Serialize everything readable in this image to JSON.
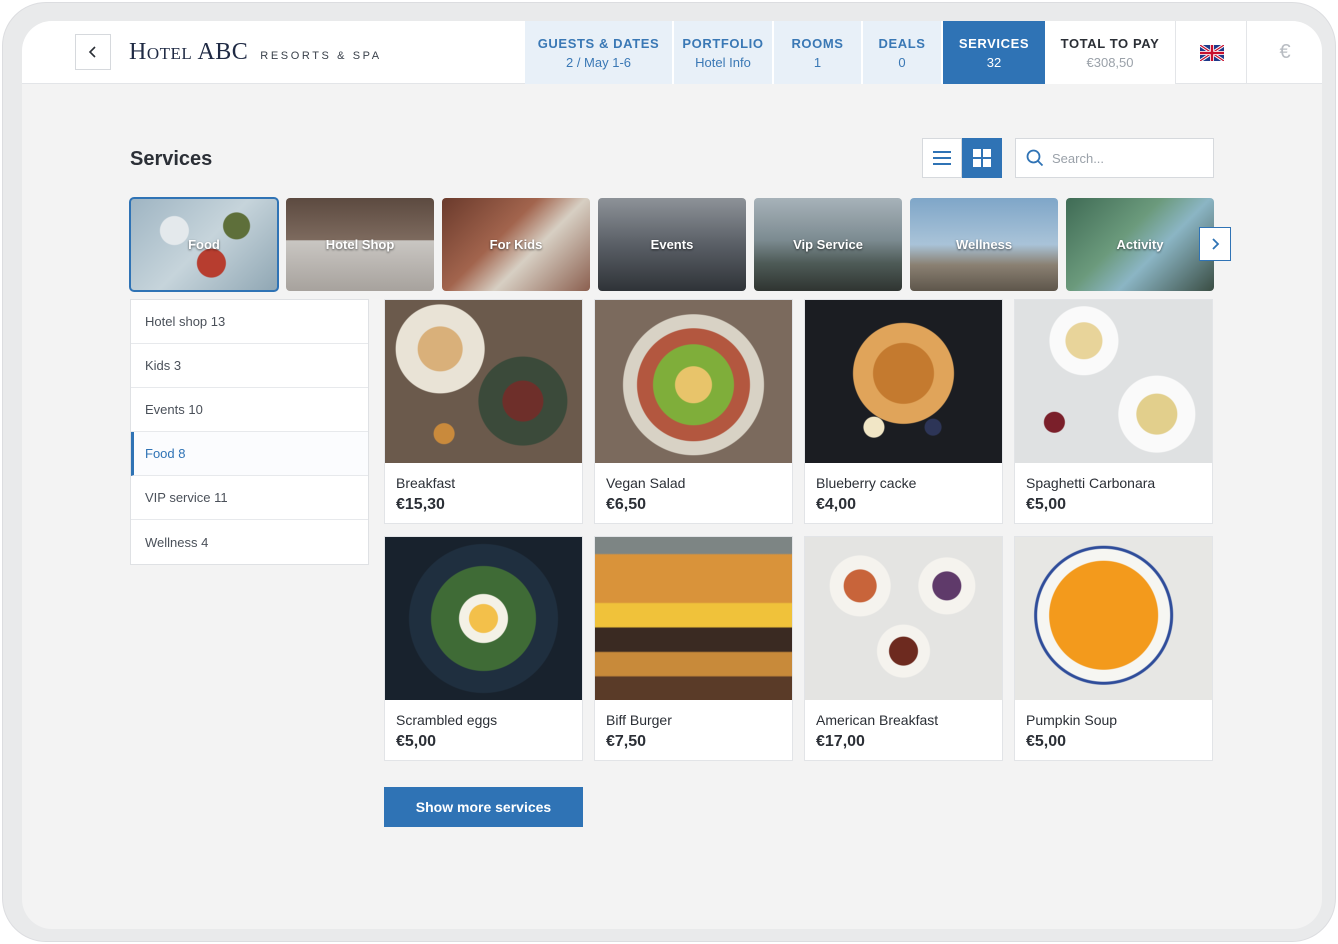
{
  "brand": {
    "name": "Hotel ABC",
    "subtitle": "RESORTS & SPA"
  },
  "nav": {
    "tabs": [
      {
        "title": "GUESTS & DATES",
        "sub": "2 / May 1-6"
      },
      {
        "title": "PORTFOLIO",
        "sub": "Hotel Info"
      },
      {
        "title": "ROOMS",
        "sub": "1"
      },
      {
        "title": "DEALS",
        "sub": "0"
      },
      {
        "title": "SERVICES",
        "sub": "32"
      }
    ],
    "total": {
      "title": "TOTAL TO PAY",
      "amount": "€308,50"
    },
    "currency_symbol": "€",
    "language_icon": "uk-flag-icon"
  },
  "page": {
    "title": "Services"
  },
  "search": {
    "placeholder": "Search..."
  },
  "categories": [
    {
      "label": "Food"
    },
    {
      "label": "Hotel Shop"
    },
    {
      "label": "For Kids"
    },
    {
      "label": "Events"
    },
    {
      "label": "Vip Service"
    },
    {
      "label": "Wellness"
    },
    {
      "label": "Activity"
    }
  ],
  "side_list": [
    {
      "label": "Hotel shop 13"
    },
    {
      "label": "Kids 3"
    },
    {
      "label": "Events 10"
    },
    {
      "label": "Food 8"
    },
    {
      "label": "VIP service 11"
    },
    {
      "label": "Wellness 4"
    }
  ],
  "products": [
    {
      "name": "Breakfast",
      "price": "€15,30"
    },
    {
      "name": "Vegan Salad",
      "price": "€6,50"
    },
    {
      "name": "Blueberry cacke",
      "price": "€4,00"
    },
    {
      "name": "Spaghetti Carbonara",
      "price": "€5,00"
    },
    {
      "name": "Scrambled eggs",
      "price": "€5,00"
    },
    {
      "name": "Biff Burger",
      "price": "€7,50"
    },
    {
      "name": "American Breakfast",
      "price": "€17,00"
    },
    {
      "name": "Pumpkin Soup",
      "price": "€5,00"
    }
  ],
  "show_more_label": "Show more services",
  "colors": {
    "accent": "#2f73b5",
    "tab_bg": "#e8f0f8",
    "page_bg": "#f3f3f3"
  }
}
